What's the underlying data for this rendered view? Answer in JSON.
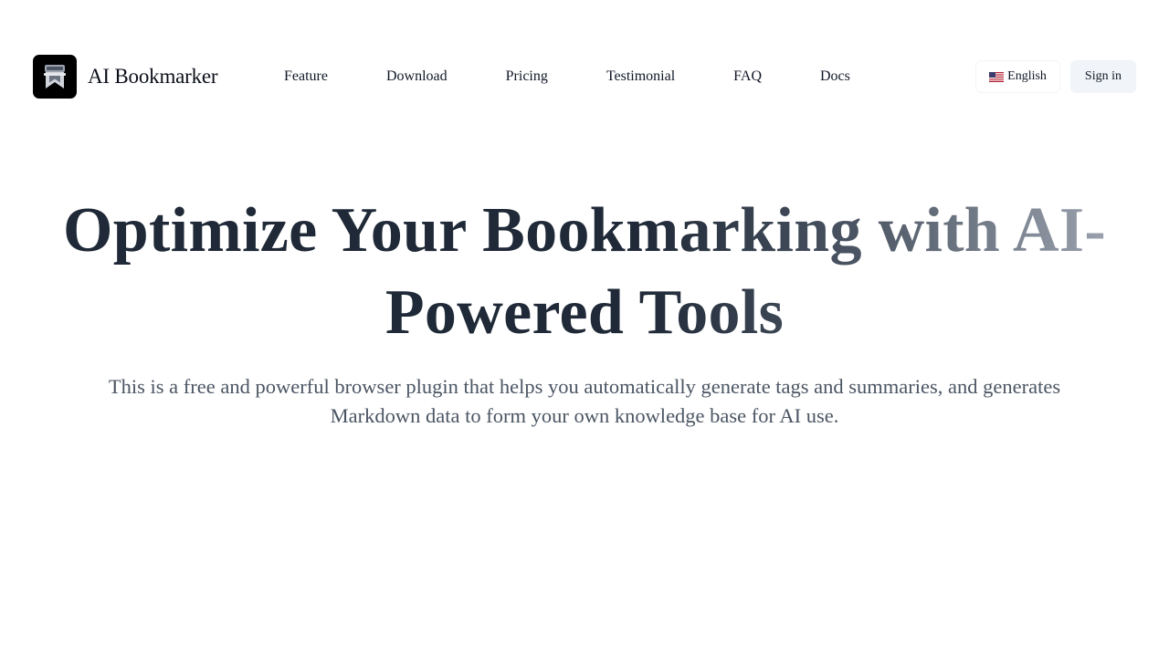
{
  "header": {
    "brand_name": "AI Bookmarker",
    "logo_icon": "bookmark-logo-icon",
    "nav": [
      {
        "label": "Feature"
      },
      {
        "label": "Download"
      },
      {
        "label": "Pricing"
      },
      {
        "label": "Testimonial"
      },
      {
        "label": "FAQ"
      },
      {
        "label": "Docs"
      }
    ],
    "language": {
      "icon": "us-flag-icon",
      "label": "English"
    },
    "signin_label": "Sign in"
  },
  "hero": {
    "title": "Optimize Your Bookmarking with AI-Powered Tools",
    "subtitle": "This is a free and powerful browser plugin that helps you automatically generate tags and summaries, and generates Markdown data to form your own knowledge base for AI use."
  },
  "colors": {
    "title_start": "#1f2937",
    "title_end": "#9ca3af",
    "signin_bg": "#f1f5f9",
    "logo_bg": "#000000"
  }
}
